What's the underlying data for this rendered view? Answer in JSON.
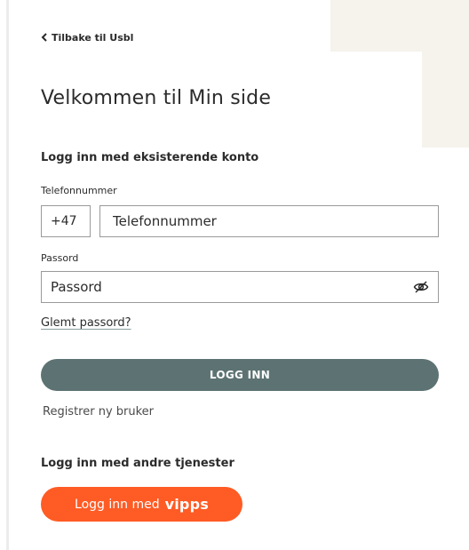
{
  "nav": {
    "back_label": "Tilbake til Usbl"
  },
  "page": {
    "title": "Velkommen til Min side"
  },
  "existing_account": {
    "heading": "Logg inn med eksisterende konto",
    "phone": {
      "label": "Telefonnummer",
      "country_code": "+47",
      "placeholder": "Telefonnummer",
      "value": ""
    },
    "password": {
      "label": "Passord",
      "placeholder": "Passord",
      "value": ""
    },
    "forgot_password": "Glemt passord?",
    "login_button": "LOGG INN",
    "register_link": "Registrer ny bruker"
  },
  "other_services": {
    "heading": "Logg inn med andre tjenester",
    "vipps_prefix": "Logg inn med",
    "vipps_logo": "vipps"
  },
  "icons": {
    "back": "chevron-left-icon",
    "password_toggle": "eye-slash-icon"
  },
  "colors": {
    "primary_button": "#5d7373",
    "vipps_orange": "#ff5b24",
    "beige_accent": "#f6f2ec"
  }
}
